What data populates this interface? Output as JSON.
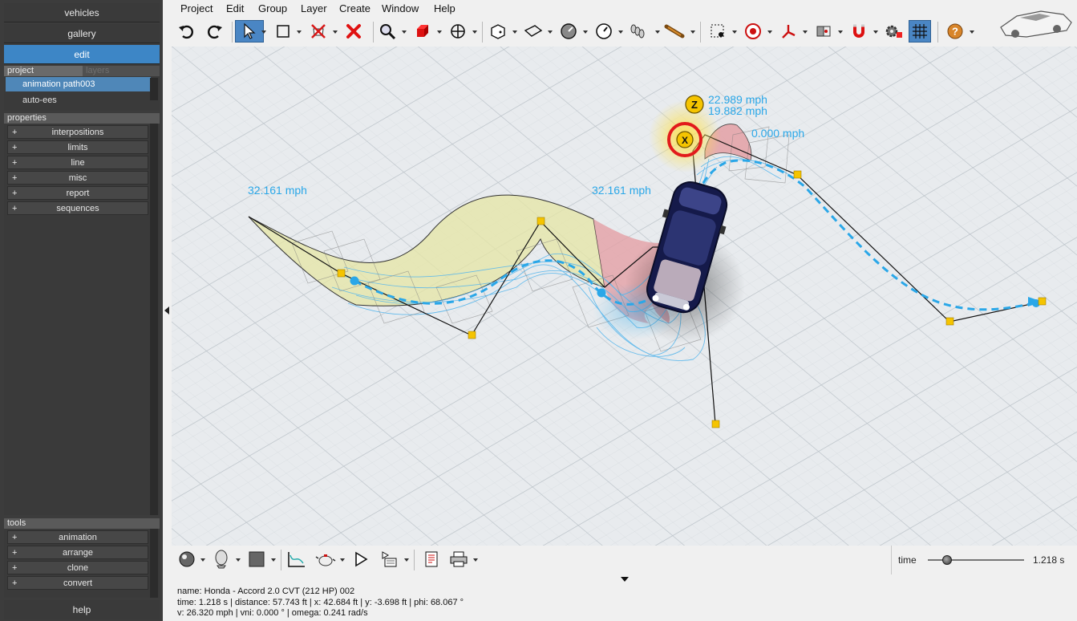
{
  "sidebar": {
    "modes": [
      "vehicles",
      "gallery",
      "edit"
    ],
    "tabs": [
      "project",
      "layers"
    ],
    "project_items": [
      "animation path003",
      "auto-ees"
    ],
    "properties_label": "properties",
    "properties": [
      "interpositions",
      "limits",
      "line",
      "misc",
      "report",
      "sequences"
    ],
    "tools_label": "tools",
    "tools": [
      "animation",
      "arrange",
      "clone",
      "convert"
    ],
    "help_label": "help"
  },
  "menu": [
    "Project",
    "Edit",
    "Group",
    "Layer",
    "Create",
    "Window",
    "Help"
  ],
  "toolbar_icons": [
    "undo-icon",
    "redo-icon",
    "select-arrow-icon",
    "marquee-icon",
    "no-vehicle-icon",
    "delete-x-icon",
    "zoom-icon",
    "cube-red-icon",
    "move-icon",
    "box-icon",
    "flag-icon",
    "gauge-icon",
    "clock-gauge-icon",
    "spring-icon",
    "baton-icon",
    "target-dot-icon",
    "target-red-icon",
    "axes-icon",
    "frame-icon",
    "magnet-icon",
    "gears-icon",
    "grid-icon",
    "help-icon"
  ],
  "viewport": {
    "labels": {
      "speed_left": "32.161 mph",
      "speed_center": "32.161 mph",
      "speed_top1": "22.989 mph",
      "speed_top2": "19.882 mph",
      "speed_right": "0.000 mph",
      "marker_z": "Z",
      "marker_x": "X"
    },
    "colors": {
      "path": "#2aa7e8",
      "yellow_zone": "#e6e6a4",
      "red_zone": "#e3a0a5",
      "marker": "#f5c400"
    }
  },
  "time": {
    "label": "time",
    "value": "1.218 s",
    "fraction": 0.2
  },
  "status": {
    "line1": "name: Honda - Accord 2.0 CVT (212 HP) 002",
    "line2": "time: 1.218 s | distance: 57.743 ft | x: 42.684 ft | y: -3.698 ft | phi: 68.067 °",
    "line3": "v: 26.320 mph | vni: 0.000 ° | omega: 0.241 rad/s"
  }
}
